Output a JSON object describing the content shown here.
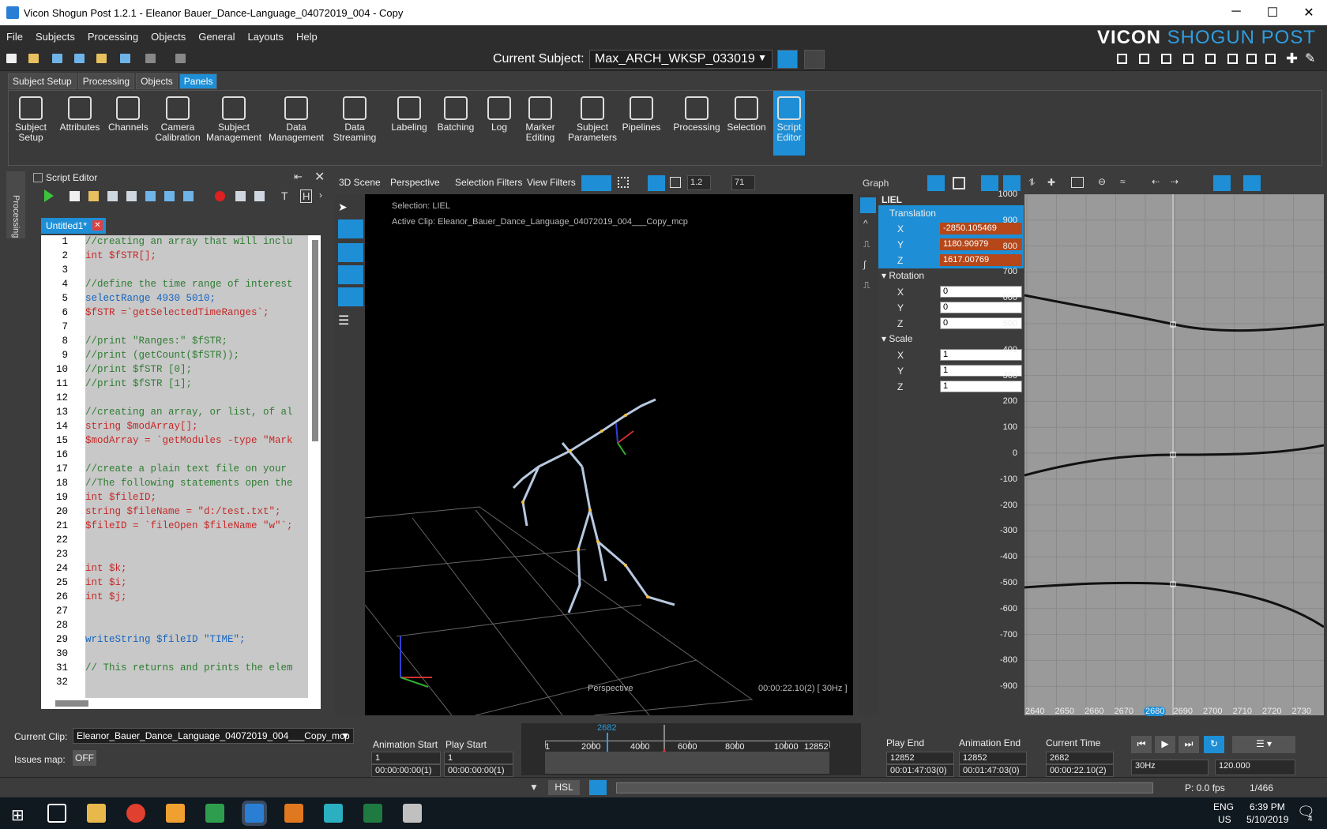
{
  "window": {
    "title": "Vicon Shogun Post 1.2.1  - Eleanor Bauer_Dance-Language_04072019_004 - Copy",
    "controls": [
      "─",
      "☐",
      "✕"
    ]
  },
  "menu": [
    "File",
    "Subjects",
    "Processing",
    "Objects",
    "General",
    "Layouts",
    "Help"
  ],
  "logo": {
    "vicon": "VICON",
    "shogun": "SHOGUN POST"
  },
  "subject": {
    "label": "Current Subject:",
    "value": "Max_ARCH_WKSP_033019"
  },
  "ribbon_tabs": [
    {
      "label": "Subject Setup",
      "active": false
    },
    {
      "label": "Processing",
      "active": false
    },
    {
      "label": "Objects",
      "active": false
    },
    {
      "label": "Panels",
      "active": true
    }
  ],
  "ribbon_buttons": [
    {
      "l1": "Subject",
      "l2": "Setup",
      "icon": "subject-setup-icon"
    },
    {
      "l1": "Attributes",
      "l2": "",
      "icon": "attributes-icon"
    },
    {
      "l1": "Channels",
      "l2": "",
      "icon": "channels-icon"
    },
    {
      "l1": "Camera",
      "l2": "Calibration",
      "icon": "camera-calibration-icon"
    },
    {
      "l1": "Subject",
      "l2": "Management",
      "icon": "subject-management-icon"
    },
    {
      "l1": "Data",
      "l2": "Management",
      "icon": "data-management-icon"
    },
    {
      "l1": "Data",
      "l2": "Streaming",
      "icon": "data-streaming-icon"
    },
    {
      "l1": "Labeling",
      "l2": "",
      "icon": "labeling-icon"
    },
    {
      "l1": "Batching",
      "l2": "",
      "icon": "batching-icon"
    },
    {
      "l1": "Log",
      "l2": "",
      "icon": "log-icon"
    },
    {
      "l1": "Marker",
      "l2": "Editing",
      "icon": "marker-editing-icon"
    },
    {
      "l1": "Subject",
      "l2": "Parameters",
      "icon": "subject-parameters-icon"
    },
    {
      "l1": "Pipelines",
      "l2": "",
      "icon": "pipelines-icon"
    },
    {
      "l1": "Processing",
      "l2": "",
      "icon": "processing-icon"
    },
    {
      "l1": "Selection",
      "l2": "",
      "icon": "selection-icon"
    },
    {
      "l1": "Script",
      "l2": "Editor",
      "icon": "script-editor-icon"
    }
  ],
  "side_tab": "Processing",
  "script_editor": {
    "title": "Script Editor",
    "tab": "Untitled1*",
    "lines": [
      {
        "n": "1",
        "t": "//creating an array that will inclu",
        "c": "cm"
      },
      {
        "n": "2",
        "t": "int $fSTR[];",
        "c": "kw"
      },
      {
        "n": "3",
        "t": "",
        "c": "tx"
      },
      {
        "n": "4",
        "t": "//define the time range of interest",
        "c": "cm"
      },
      {
        "n": "5",
        "t": "selectRange 4930 5010;",
        "c": "fn"
      },
      {
        "n": "6",
        "t": "$fSTR =`getSelectedTimeRanges`;",
        "c": "kw"
      },
      {
        "n": "7",
        "t": "",
        "c": "tx"
      },
      {
        "n": "8",
        "t": "//print \"Ranges:\" $fSTR;",
        "c": "cm"
      },
      {
        "n": "9",
        "t": "//print (getCount($fSTR));",
        "c": "cm"
      },
      {
        "n": "10",
        "t": "//print $fSTR [0];",
        "c": "cm"
      },
      {
        "n": "11",
        "t": "//print $fSTR [1];",
        "c": "cm"
      },
      {
        "n": "12",
        "t": "",
        "c": "tx"
      },
      {
        "n": "13",
        "t": "//creating an array, or list, of al",
        "c": "cm"
      },
      {
        "n": "14",
        "t": "string $modArray[];",
        "c": "kw"
      },
      {
        "n": "15",
        "t": "$modArray = `getModules -type \"Mark",
        "c": "kw"
      },
      {
        "n": "16",
        "t": "",
        "c": "tx"
      },
      {
        "n": "17",
        "t": "//create a plain text file on your",
        "c": "cm"
      },
      {
        "n": "18",
        "t": "//The following statements open the",
        "c": "cm"
      },
      {
        "n": "19",
        "t": "int $fileID;",
        "c": "kw"
      },
      {
        "n": "20",
        "t": "string $fileName = \"d:/test.txt\";",
        "c": "kw"
      },
      {
        "n": "21",
        "t": "$fileID = `fileOpen $fileName \"w\"`;",
        "c": "kw"
      },
      {
        "n": "22",
        "t": "",
        "c": "tx"
      },
      {
        "n": "23",
        "t": "",
        "c": "tx"
      },
      {
        "n": "24",
        "t": "int $k;",
        "c": "kw"
      },
      {
        "n": "25",
        "t": "int $i;",
        "c": "kw"
      },
      {
        "n": "26",
        "t": "int $j;",
        "c": "kw"
      },
      {
        "n": "27",
        "t": "",
        "c": "tx"
      },
      {
        "n": "28",
        "t": "",
        "c": "tx"
      },
      {
        "n": "29",
        "t": "writeString $fileID \"TIME\";",
        "c": "fn"
      },
      {
        "n": "30",
        "t": "",
        "c": "tx"
      },
      {
        "n": "31",
        "t": "// This returns and prints the elem",
        "c": "cm"
      },
      {
        "n": "32",
        "t": "",
        "c": "tx"
      }
    ]
  },
  "viewport": {
    "scene_btn": "3D Scene",
    "camera_btn": "Perspective",
    "filters_btn": "Selection Filters",
    "view_filters_btn": "View Filters",
    "zoom_value": "1.2",
    "fov_value": "71",
    "selection": "Selection: LIEL",
    "active_clip": "Active Clip: Eleanor_Bauer_Dance_Language_04072019_004___Copy_mcp",
    "camera_name": "Perspective",
    "timecode": "00:00:22.10(2) [ 30Hz ]"
  },
  "attributes": {
    "graph_btn": "Graph",
    "object": "LIEL",
    "translation": {
      "label": "Translation",
      "x": "-2850.105469",
      "y": "1180.90979",
      "z": "1617.00769"
    },
    "rotation": {
      "label": "Rotation",
      "x": "0",
      "y": "0",
      "z": "0"
    },
    "scale": {
      "label": "Scale",
      "x": "1",
      "y": "1",
      "z": "1"
    },
    "axis_labels": [
      "X",
      "Y",
      "Z"
    ]
  },
  "graph": {
    "y_ticks": [
      "1000",
      "900",
      "800",
      "700",
      "600",
      "500",
      "400",
      "300",
      "200",
      "100",
      "0",
      "-100",
      "-200",
      "-300",
      "-400",
      "-500",
      "-600",
      "-700",
      "-800",
      "-900"
    ],
    "x_ticks": [
      "2640",
      "2650",
      "2660",
      "2670",
      "2680",
      "2690",
      "2700",
      "2710",
      "2720",
      "2730"
    ],
    "current_frame": "2680"
  },
  "bottom": {
    "clip_label": "Current Clip:",
    "clip_value": "Eleanor_Bauer_Dance_Language_04072019_004___Copy_mcp",
    "issues_label": "Issues map:",
    "issues_value": "OFF",
    "anim_start_label": "Animation Start",
    "anim_start_frame": "1",
    "anim_start_time": "00:00:00:00(1)",
    "play_start_label": "Play Start",
    "play_start_frame": "1",
    "play_start_time": "00:00:00:00(1)",
    "play_end_label": "Play End",
    "play_end_frame": "12852",
    "play_end_time": "00:01:47:03(0)",
    "anim_end_label": "Animation End",
    "anim_end_frame": "12852",
    "anim_end_time": "00:01:47:03(0)",
    "current_time_label": "Current Time",
    "current_frame": "2682",
    "current_time": "00:00:22.10(2)",
    "timeline_ticks": [
      "1",
      "2000",
      "4000",
      "6000",
      "8000",
      "10000",
      "12852"
    ],
    "timeline_cursor": "2682",
    "rate_value": "30Hz",
    "speed_value": "120.000",
    "hsl": "HSL",
    "fps": "P: 0.0 fps",
    "frames": "1/466"
  },
  "taskbar": {
    "lang1": "ENG",
    "lang2": "US",
    "time": "6:39 PM",
    "date": "5/10/2019",
    "notifications": "4"
  }
}
